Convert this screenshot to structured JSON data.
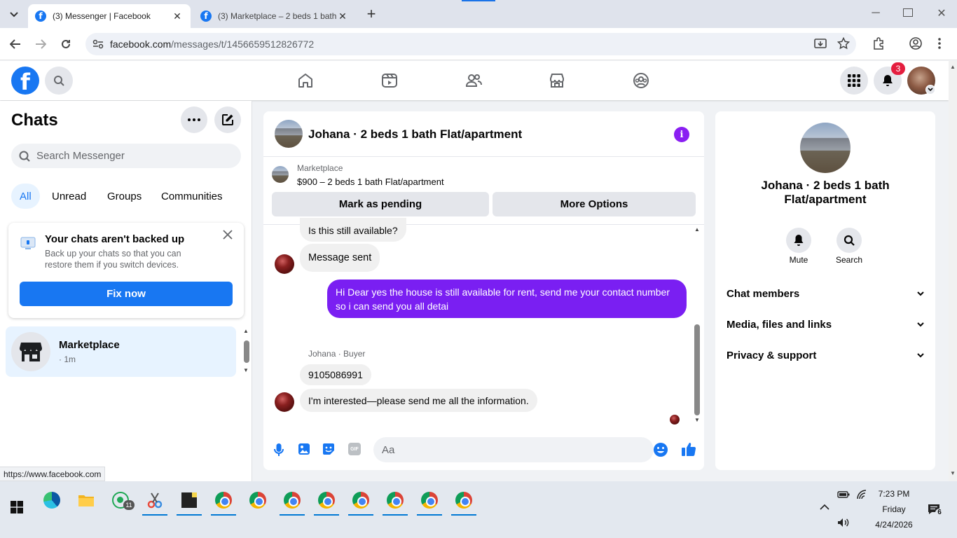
{
  "browser": {
    "tabs": [
      {
        "title": "(3) Messenger | Facebook",
        "active": true
      },
      {
        "title": "(3) Marketplace – 2 beds 1 bath",
        "active": false
      }
    ],
    "url_host": "facebook.com",
    "url_path": "/messages/t/1456659512826772",
    "status_url": "https://www.facebook.com"
  },
  "fb_header": {
    "notifications_badge": "3",
    "brand_color": "#1877f2"
  },
  "left": {
    "title": "Chats",
    "search_placeholder": "Search Messenger",
    "filters": [
      "All",
      "Unread",
      "Groups",
      "Communities"
    ],
    "backup": {
      "title": "Your chats aren't backed up",
      "body": "Back up your chats so that you can restore them if you switch devices.",
      "button": "Fix now"
    },
    "thread": {
      "name": "Marketplace",
      "meta": "· 1m"
    }
  },
  "conversation": {
    "title": "Johana · 2 beds 1 bath Flat/apartment",
    "listing_source": "Marketplace",
    "listing_title": "$900 – 2 beds 1 bath Flat/apartment",
    "buttons": [
      "Mark as pending",
      "More Options"
    ],
    "messages": {
      "m1": "Is this still available?",
      "m2": "Message sent",
      "m3": "Hi Dear yes the house is still available for rent, send me your contact number so i can send you all detai",
      "sender_label": "Johana · Buyer",
      "m4": "9105086991",
      "m5": "I'm interested—please send me all the information."
    },
    "composer_placeholder": "Aa",
    "outgoing_color": "#7a1ff2"
  },
  "right": {
    "name": "Johana · 2 beds 1 bath Flat/apartment",
    "actions": [
      "Mute",
      "Search"
    ],
    "sections": [
      "Chat members",
      "Media, files and links",
      "Privacy & support"
    ]
  },
  "taskbar": {
    "time": "7:23 PM",
    "day": "Friday",
    "date": "4/24/2026",
    "whatsapp_badge": "11",
    "notif_badge": "6"
  }
}
